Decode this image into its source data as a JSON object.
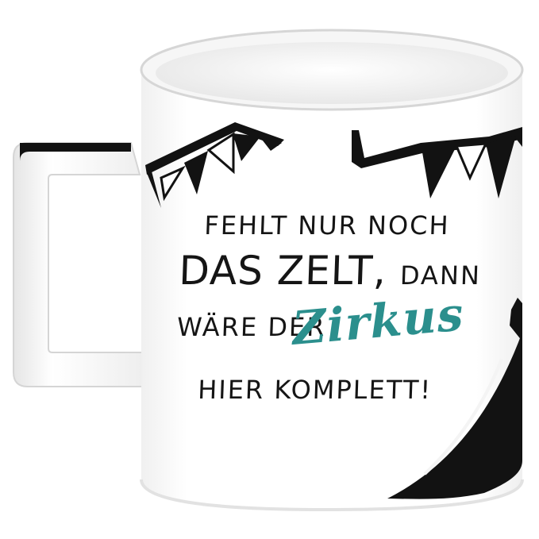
{
  "product": {
    "mug_color": "#ffffff",
    "handle_color": "#f8f8f8",
    "accent_color": "#2b8f8d",
    "graphic_color": "#121212",
    "rim_color": "#dedede"
  },
  "quote": {
    "line1": "FEHLT NUR NOCH",
    "line2_main": "DAS ZELT,",
    "line2_tail": "DANN",
    "line3_lead": "WÄRE DER",
    "accent_word": "Zirkus",
    "line4": "HIER KOMPLETT!"
  }
}
